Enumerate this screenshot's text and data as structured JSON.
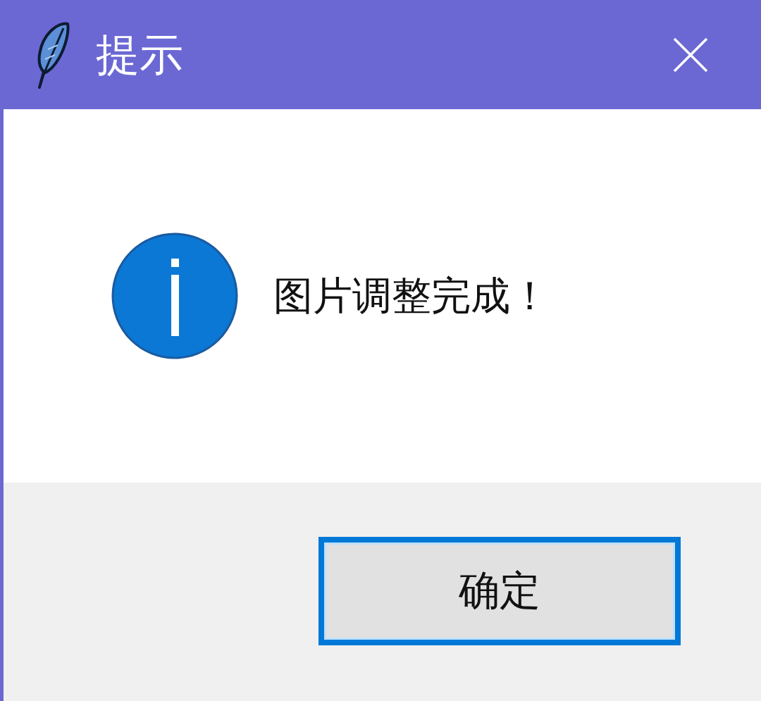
{
  "window": {
    "title": "提示"
  },
  "message": {
    "kind": "info",
    "text": "图片调整完成！"
  },
  "buttons": [
    {
      "label": "确定",
      "focused": true
    }
  ]
}
